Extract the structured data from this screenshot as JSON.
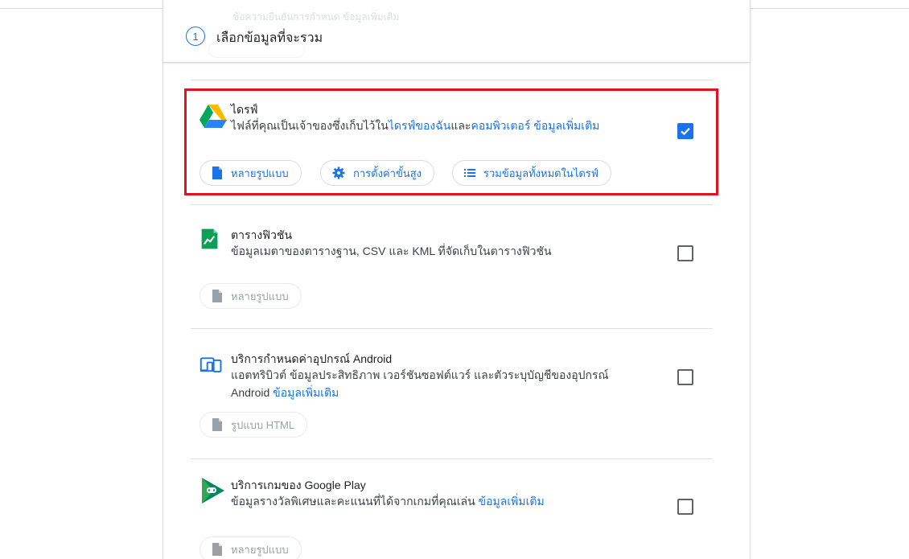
{
  "step": {
    "number": "1",
    "title": "เลือกข้อมูลที่จะรวม",
    "ghost_text": "ข้อความยืนยันการกำหนด ข้อมูลเพิ่มเติม"
  },
  "products": [
    {
      "id": "drive",
      "icon": "google-drive-icon",
      "title": "ไดรฟ์",
      "desc_prefix": "ไฟล์ที่คุณเป็นเจ้าของซึ่งเก็บไว้ใน",
      "link1": "ไดรฟ์ของฉัน",
      "desc_mid": "และ",
      "link2": "คอมพิวเตอร์",
      "link3": "ข้อมูลเพิ่มเติม",
      "checked": true,
      "chips": [
        {
          "icon": "file-icon",
          "label": "หลายรูปแบบ"
        },
        {
          "icon": "gear-icon",
          "label": "การตั้งค่าขั้นสูง"
        },
        {
          "icon": "list-icon",
          "label": "รวมข้อมูลทั้งหมดในไดรฟ์"
        }
      ]
    },
    {
      "id": "fusion",
      "icon": "fusion-tables-icon",
      "title": "ตารางฟิวชัน",
      "desc": "ข้อมูลเมตาของตารางฐาน, CSV และ KML ที่จัดเก็บในตารางฟิวชัน",
      "checked": false,
      "chips": [
        {
          "icon": "file-icon",
          "label": "หลายรูปแบบ"
        }
      ]
    },
    {
      "id": "android",
      "icon": "android-devices-icon",
      "title": "บริการกำหนดค่าอุปกรณ์ Android",
      "desc_line1": "แอตทริบิวต์ ข้อมูลประสิทธิภาพ เวอร์ชันซอฟต์แวร์ และตัวระบุบัญชีของอุปกรณ์",
      "desc_line2": "Android",
      "link": "ข้อมูลเพิ่มเติม",
      "checked": false,
      "chips": [
        {
          "icon": "file-icon",
          "label": "รูปแบบ HTML"
        }
      ]
    },
    {
      "id": "playgames",
      "icon": "google-play-games-icon",
      "title": "บริการเกมของ Google Play",
      "desc": "ข้อมูลรางวัลพิเศษและคะแนนที่ได้จากเกมที่คุณเล่น",
      "link": "ข้อมูลเพิ่มเติม",
      "checked": false,
      "chips": [
        {
          "icon": "file-icon",
          "label": "หลายรูปแบบ"
        }
      ]
    }
  ],
  "colors": {
    "accent": "#1a73e8",
    "highlight": "#e0131f",
    "disabled": "#9aa0a6"
  }
}
